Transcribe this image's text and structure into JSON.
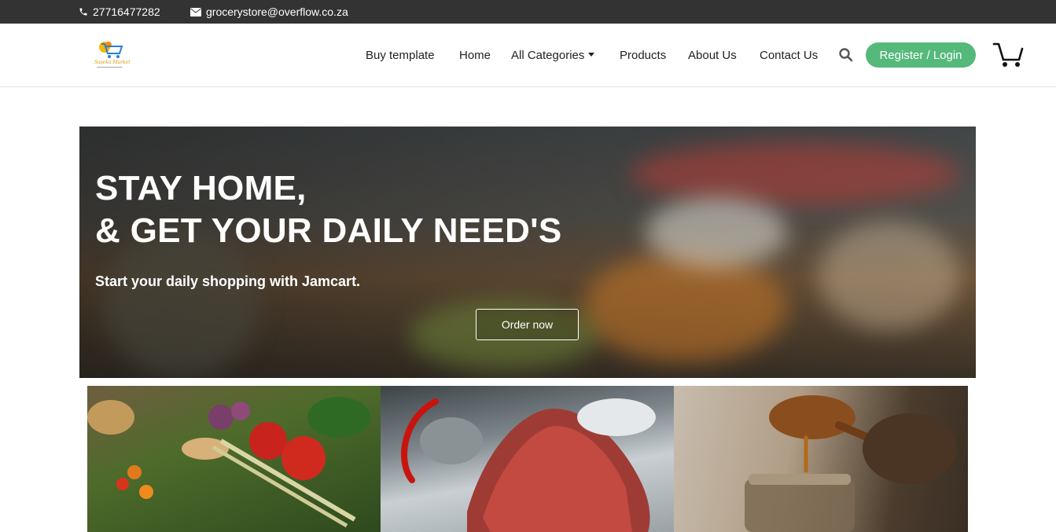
{
  "topbar": {
    "phone": "27716477282",
    "email": "grocerystore@overflow.co.za"
  },
  "brand": {
    "logo_text": "Saseka Market",
    "icon": "shopping-cart-logo-icon",
    "accent": "#f5b800"
  },
  "nav": {
    "items": [
      {
        "label": "Buy template"
      },
      {
        "label": "Home"
      },
      {
        "label": "All Categories",
        "icon": "caret-down-icon"
      },
      {
        "label": "Products"
      },
      {
        "label": "About Us"
      },
      {
        "label": "Contact Us"
      }
    ],
    "search_icon": "search-icon",
    "auth_label": "Register / Login",
    "auth_color": "#55b97a",
    "cart_icon": "cart-icon"
  },
  "hero": {
    "title_line1": "STAY HOME,",
    "title_line2": "& GET YOUR DAILY NEED'S",
    "subtitle": "Start your daily shopping with Jamcart.",
    "cta_label": "Order now"
  },
  "categories": [
    {
      "image": "vegetables-image"
    },
    {
      "image": "meat-steak-image"
    },
    {
      "image": "honey-jar-image"
    }
  ],
  "colors": {
    "topbar_bg": "#333333",
    "header_bg": "#ffffff",
    "text": "#222222"
  }
}
